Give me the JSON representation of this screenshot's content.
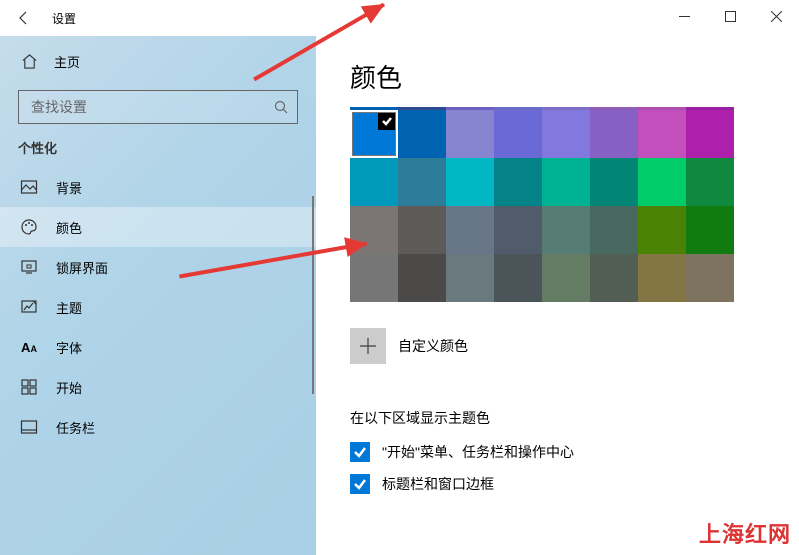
{
  "window": {
    "title": "设置"
  },
  "sidebar": {
    "home": "主页",
    "search_placeholder": "查找设置",
    "section": "个性化",
    "items": [
      {
        "label": "背景",
        "icon": "picture-icon"
      },
      {
        "label": "颜色",
        "icon": "palette-icon",
        "selected": true
      },
      {
        "label": "锁屏界面",
        "icon": "lockscreen-icon"
      },
      {
        "label": "主题",
        "icon": "theme-icon"
      },
      {
        "label": "字体",
        "icon": "font-icon"
      },
      {
        "label": "开始",
        "icon": "start-icon"
      },
      {
        "label": "任务栏",
        "icon": "taskbar-icon"
      }
    ]
  },
  "content": {
    "title": "颜色",
    "custom_color_label": "自定义颜色",
    "accent_heading": "在以下区域显示主题色",
    "accent_options": [
      {
        "label": "\"开始\"菜单、任务栏和操作中心",
        "checked": true
      },
      {
        "label": "标题栏和窗口边框",
        "checked": true
      }
    ],
    "highlight_row": [
      "#0063b1",
      "#2d4a90",
      "#6c5fbf",
      "#6a6cca",
      "#7c6ec9",
      "#925eb5",
      "#af4eb1",
      "#9b1fa2"
    ],
    "swatches": [
      [
        "#0078d7",
        "#0063b1",
        "#8785d0",
        "#6b69d6",
        "#8378de",
        "#8660c5",
        "#c24fbb",
        "#ae1fab"
      ],
      [
        "#0099bc",
        "#2d7d9a",
        "#00b7c3",
        "#038387",
        "#00b294",
        "#018574",
        "#00cc6a",
        "#10893e"
      ],
      [
        "#7b7574",
        "#5d5a58",
        "#68768a",
        "#515c6b",
        "#567c73",
        "#486860",
        "#498205",
        "#107c10"
      ],
      [
        "#767676",
        "#4c4a48",
        "#69797e",
        "#4a5459",
        "#647c64",
        "#525e54",
        "#847545",
        "#7e735f"
      ]
    ],
    "selected_swatch": {
      "row": 0,
      "col": 0
    }
  },
  "watermark": "上海红网"
}
